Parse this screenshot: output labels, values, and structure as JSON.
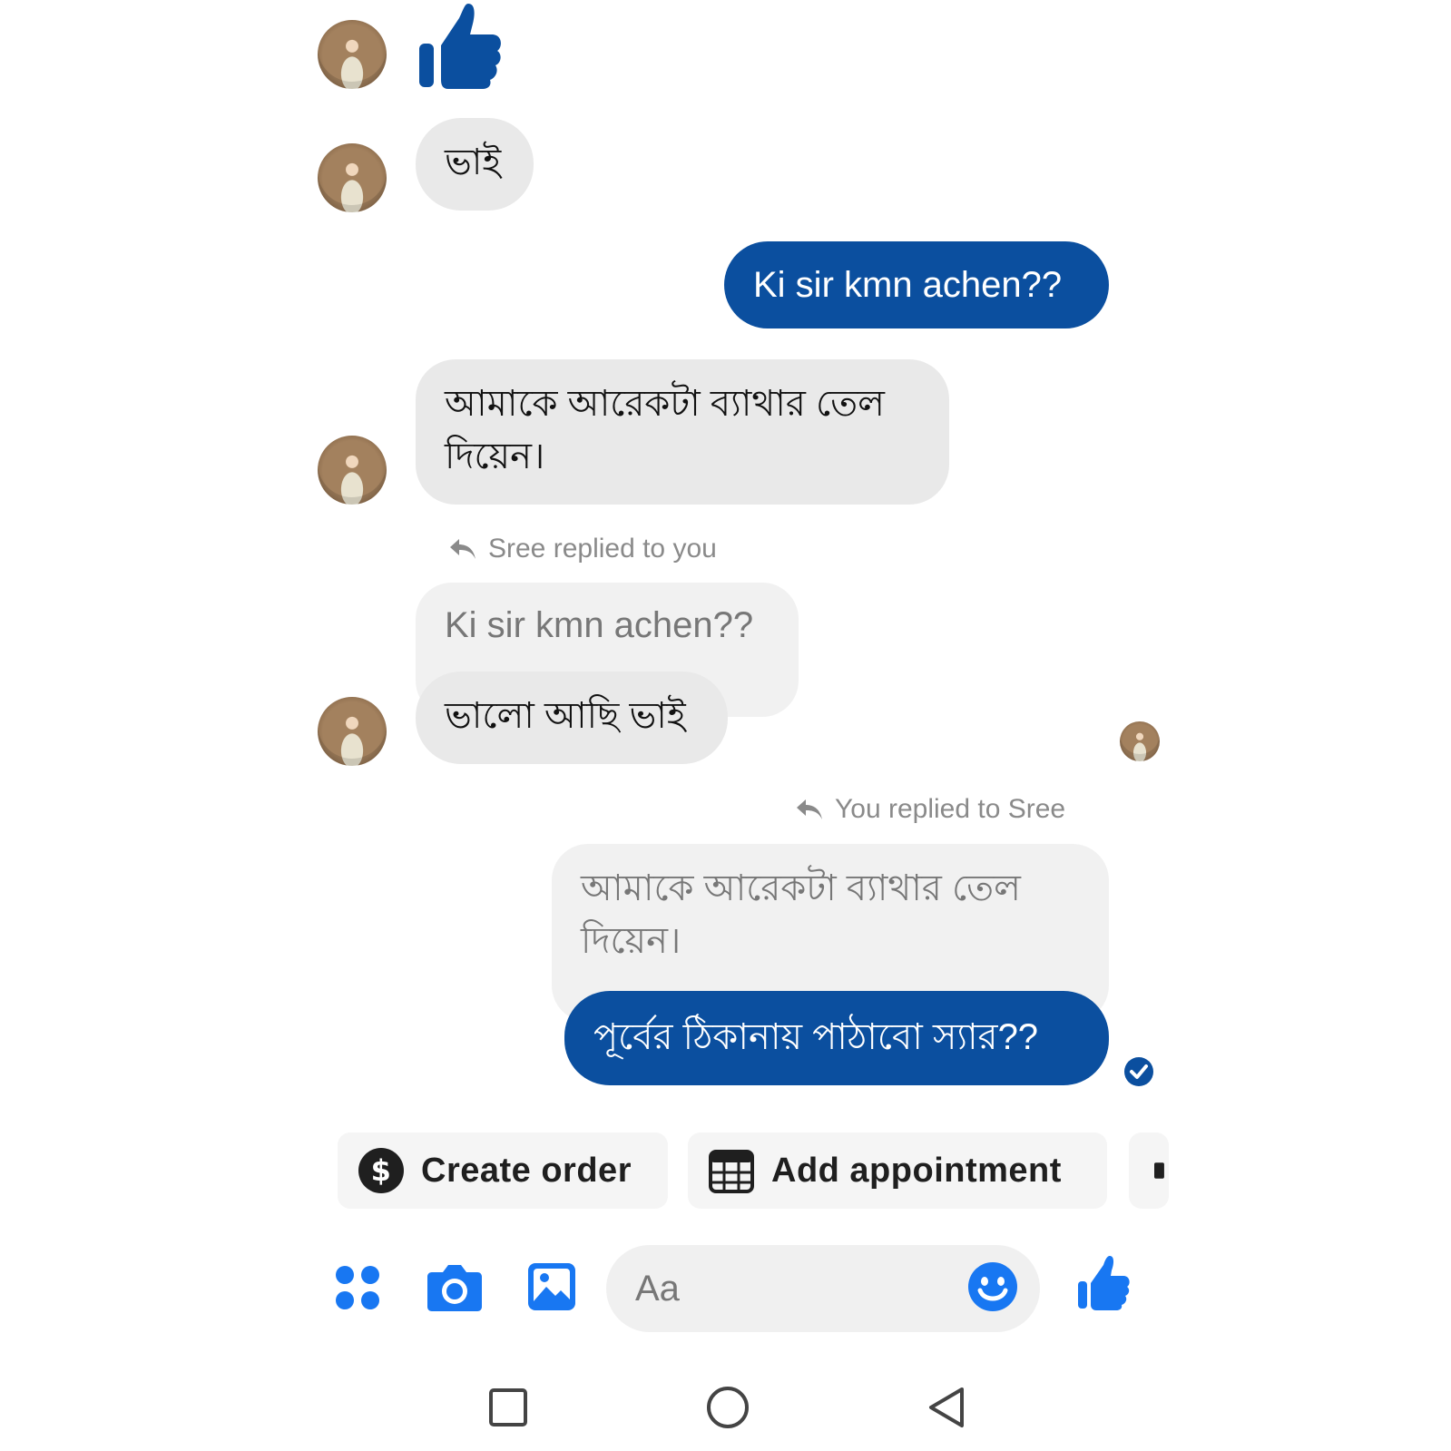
{
  "messages": {
    "m2_text": "ভাই",
    "m3_text": "Ki sir kmn achen??",
    "m4_text": "আমাকে আরেকটা ব্যাথার তেল দিয়েন।",
    "m5_reply_note": "Sree replied to you",
    "m5_quoted": "Ki sir kmn achen??",
    "m5_text": "ভালো আছি ভাই",
    "m6_reply_note": "You replied to Sree",
    "m6_quoted": "আমাকে আরেকটা ব্যাথার তেল দিয়েন।",
    "m6_text": "পূর্বের ঠিকানায় পাঠাবো স্যার??"
  },
  "quick_actions": {
    "create_order": "Create order",
    "add_appointment": "Add appointment"
  },
  "composer": {
    "placeholder": "Aa"
  },
  "colors": {
    "accent": "#0b4f9f",
    "icon_blue": "#1877f2",
    "bubble_in": "#e9e9e9"
  }
}
